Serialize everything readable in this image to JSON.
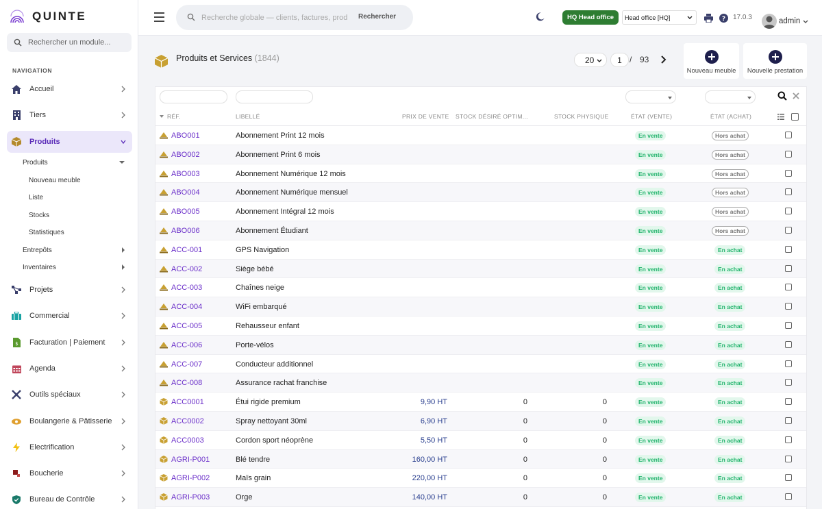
{
  "brand": {
    "name": "QUINTE"
  },
  "sidebar": {
    "search_placeholder": "Rechercher un module...",
    "heading": "NAVIGATION",
    "items": [
      {
        "label": "Accueil",
        "icon": "home-icon",
        "active": false
      },
      {
        "label": "Tiers",
        "icon": "building-icon",
        "active": false
      },
      {
        "label": "Produits",
        "icon": "box-icon",
        "active": true
      },
      {
        "label": "Projets",
        "icon": "sitemap-icon",
        "active": false
      },
      {
        "label": "Commercial",
        "icon": "suitcase-icon",
        "active": false
      },
      {
        "label": "Facturation | Paiement",
        "icon": "invoice-icon",
        "active": false
      },
      {
        "label": "Agenda",
        "icon": "calendar-icon",
        "active": false
      },
      {
        "label": "Outils spéciaux",
        "icon": "tools-icon",
        "active": false
      },
      {
        "label": "Boulangerie & Pâtisserie",
        "icon": "eye-icon",
        "active": false
      },
      {
        "label": "Electrification",
        "icon": "bolt-icon",
        "active": false
      },
      {
        "label": "Boucherie",
        "icon": "meat-icon",
        "active": false
      },
      {
        "label": "Bureau de Contrôle",
        "icon": "shield-icon",
        "active": false
      }
    ],
    "submenu": {
      "group": "Produits",
      "children": [
        "Nouveau meuble",
        "Liste",
        "Stocks",
        "Statistiques"
      ],
      "extra": [
        "Entrepôts",
        "Inventaires"
      ]
    }
  },
  "header": {
    "search_placeholder": "Recherche globale — clients, factures, prod",
    "search_button": "Rechercher",
    "entity_badge": "HQ  Head office",
    "entity_select": "Head office [HQ]",
    "version": "17.0.3",
    "user": "admin"
  },
  "page": {
    "title": "Produits et Services",
    "count": "(1844)",
    "page_size": "20",
    "current_page": "1",
    "separator": "/",
    "total_pages": "93",
    "actions": [
      {
        "label": "Nouveau meuble"
      },
      {
        "label": "Nouvelle prestation"
      }
    ]
  },
  "table": {
    "columns": {
      "ref": "RÉF.",
      "label": "LIBELLÉ",
      "price": "PRIX DE VENTE",
      "stock_desired": "STOCK DÉSIRÉ OPTIM...",
      "stock_physical": "STOCK PHYSIQUE",
      "state_sell": "ÉTAT (VENTE)",
      "state_buy": "ÉTAT (ACHAT)"
    },
    "rows": [
      {
        "ref": "ABO001",
        "label": "Abonnement Print 12 mois",
        "type": "service",
        "price": "",
        "stock_desired": "",
        "stock_physical": "",
        "sell": "En vente",
        "buy": "Hors achat",
        "buy_on": false
      },
      {
        "ref": "ABO002",
        "label": "Abonnement Print 6 mois",
        "type": "service",
        "price": "",
        "stock_desired": "",
        "stock_physical": "",
        "sell": "En vente",
        "buy": "Hors achat",
        "buy_on": false
      },
      {
        "ref": "ABO003",
        "label": "Abonnement Numérique 12 mois",
        "type": "service",
        "price": "",
        "stock_desired": "",
        "stock_physical": "",
        "sell": "En vente",
        "buy": "Hors achat",
        "buy_on": false
      },
      {
        "ref": "ABO004",
        "label": "Abonnement Numérique mensuel",
        "type": "service",
        "price": "",
        "stock_desired": "",
        "stock_physical": "",
        "sell": "En vente",
        "buy": "Hors achat",
        "buy_on": false
      },
      {
        "ref": "ABO005",
        "label": "Abonnement Intégral 12 mois",
        "type": "service",
        "price": "",
        "stock_desired": "",
        "stock_physical": "",
        "sell": "En vente",
        "buy": "Hors achat",
        "buy_on": false
      },
      {
        "ref": "ABO006",
        "label": "Abonnement Étudiant",
        "type": "service",
        "price": "",
        "stock_desired": "",
        "stock_physical": "",
        "sell": "En vente",
        "buy": "Hors achat",
        "buy_on": false
      },
      {
        "ref": "ACC-001",
        "label": "GPS Navigation",
        "type": "service",
        "price": "",
        "stock_desired": "",
        "stock_physical": "",
        "sell": "En vente",
        "buy": "En achat",
        "buy_on": true
      },
      {
        "ref": "ACC-002",
        "label": "Siège bébé",
        "type": "service",
        "price": "",
        "stock_desired": "",
        "stock_physical": "",
        "sell": "En vente",
        "buy": "En achat",
        "buy_on": true
      },
      {
        "ref": "ACC-003",
        "label": "Chaînes neige",
        "type": "service",
        "price": "",
        "stock_desired": "",
        "stock_physical": "",
        "sell": "En vente",
        "buy": "En achat",
        "buy_on": true
      },
      {
        "ref": "ACC-004",
        "label": "WiFi embarqué",
        "type": "service",
        "price": "",
        "stock_desired": "",
        "stock_physical": "",
        "sell": "En vente",
        "buy": "En achat",
        "buy_on": true
      },
      {
        "ref": "ACC-005",
        "label": "Rehausseur enfant",
        "type": "service",
        "price": "",
        "stock_desired": "",
        "stock_physical": "",
        "sell": "En vente",
        "buy": "En achat",
        "buy_on": true
      },
      {
        "ref": "ACC-006",
        "label": "Porte-vélos",
        "type": "service",
        "price": "",
        "stock_desired": "",
        "stock_physical": "",
        "sell": "En vente",
        "buy": "En achat",
        "buy_on": true
      },
      {
        "ref": "ACC-007",
        "label": "Conducteur additionnel",
        "type": "service",
        "price": "",
        "stock_desired": "",
        "stock_physical": "",
        "sell": "En vente",
        "buy": "En achat",
        "buy_on": true
      },
      {
        "ref": "ACC-008",
        "label": "Assurance rachat franchise",
        "type": "service",
        "price": "",
        "stock_desired": "",
        "stock_physical": "",
        "sell": "En vente",
        "buy": "En achat",
        "buy_on": true
      },
      {
        "ref": "ACC0001",
        "label": "Étui rigide premium",
        "type": "product",
        "price": "9,90 HT",
        "stock_desired": "0",
        "stock_physical": "0",
        "sell": "En vente",
        "buy": "En achat",
        "buy_on": true
      },
      {
        "ref": "ACC0002",
        "label": "Spray nettoyant 30ml",
        "type": "product",
        "price": "6,90 HT",
        "stock_desired": "0",
        "stock_physical": "0",
        "sell": "En vente",
        "buy": "En achat",
        "buy_on": true
      },
      {
        "ref": "ACC0003",
        "label": "Cordon sport néoprène",
        "type": "product",
        "price": "5,50 HT",
        "stock_desired": "0",
        "stock_physical": "0",
        "sell": "En vente",
        "buy": "En achat",
        "buy_on": true
      },
      {
        "ref": "AGRI-P001",
        "label": "Blé tendre",
        "type": "product",
        "price": "160,00 HT",
        "stock_desired": "0",
        "stock_physical": "0",
        "sell": "En vente",
        "buy": "En achat",
        "buy_on": true
      },
      {
        "ref": "AGRI-P002",
        "label": "Maïs grain",
        "type": "product",
        "price": "220,00 HT",
        "stock_desired": "0",
        "stock_physical": "0",
        "sell": "En vente",
        "buy": "En achat",
        "buy_on": true
      },
      {
        "ref": "AGRI-P003",
        "label": "Orge",
        "type": "product",
        "price": "140,00 HT",
        "stock_desired": "0",
        "stock_physical": "0",
        "sell": "En vente",
        "buy": "En achat",
        "buy_on": true
      }
    ]
  },
  "colors": {
    "accent": "#6a2ec9",
    "active_bg": "#ebe7fa",
    "success": "#20b36b",
    "entity_badge": "#2e7d32",
    "plus_button": "#1e1f4d",
    "product_icon": "#c8a032"
  }
}
